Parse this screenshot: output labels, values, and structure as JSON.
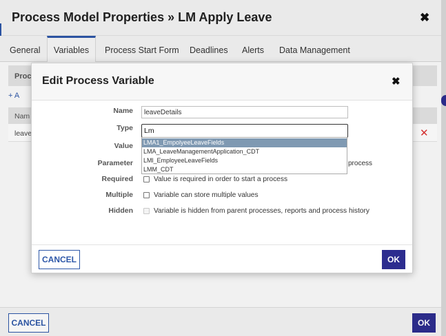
{
  "outer_dialog": {
    "title": "Process Model Properties » LM Apply Leave",
    "close_glyph": "✖",
    "tabs": [
      {
        "label": "General"
      },
      {
        "label": "Variables"
      },
      {
        "label": "Process Start Form"
      },
      {
        "label": "Deadlines"
      },
      {
        "label": "Alerts"
      },
      {
        "label": "Data Management"
      }
    ],
    "active_tab": "Variables",
    "panel_header": "Proc",
    "add_link": "+ A",
    "column_header": "Nam",
    "row_value": "leavel",
    "delete_glyph": "✕",
    "cancel_label": "CANCEL",
    "ok_label": "OK"
  },
  "modal": {
    "title": "Edit Process Variable",
    "close_glyph": "✖",
    "labels": {
      "name": "Name",
      "type": "Type",
      "value": "Value",
      "parameter": "Parameter",
      "required": "Required",
      "multiple": "Multiple",
      "hidden": "Hidden"
    },
    "name_value": "leaveDetails",
    "type_value": "Lm",
    "dropdown_options": [
      {
        "label": "LMA1_EmpolyeeLeaveFields",
        "selected": true
      },
      {
        "label": "LMA_LeaveManagementApplication_CDT",
        "selected": false
      },
      {
        "label": "LMl_EmployeeLeaveFields",
        "selected": false
      },
      {
        "label": "LMM_CDT",
        "selected": false
      }
    ],
    "parameter_tail": "process",
    "checkboxes": {
      "required": "Value is required in order to start a process",
      "multiple": "Variable can store multiple values",
      "hidden": "Variable is hidden from parent processes, reports and process history"
    },
    "cancel_label": "CANCEL",
    "ok_label": "OK"
  },
  "colors": {
    "accent_blue": "#2d57a8",
    "primary_button": "#2d2d8f",
    "dropdown_selected": "#7f99b2",
    "delete_red": "#dd3333"
  }
}
